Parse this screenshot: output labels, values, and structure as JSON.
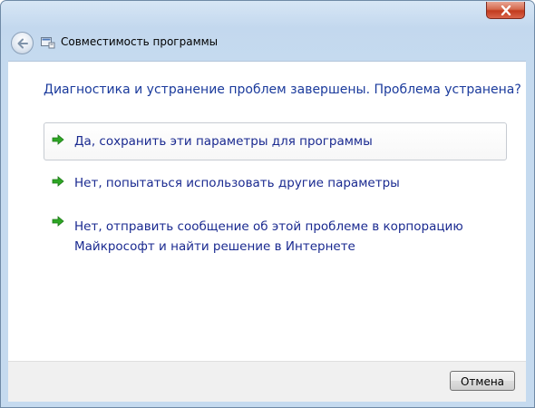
{
  "window": {
    "title": "Совместимость программы"
  },
  "heading": "Диагностика и устранение проблем завершены. Проблема устранена?",
  "options": [
    {
      "label": "Да, сохранить эти параметры для программы",
      "icon": "green-arrow-icon",
      "selected": true
    },
    {
      "label": "Нет, попытаться использовать другие параметры",
      "icon": "green-arrow-icon",
      "selected": false
    },
    {
      "label": "Нет, отправить сообщение об этой проблеме в корпорацию Майкрософт и найти решение в Интернете",
      "icon": "green-arrow-icon",
      "selected": false
    }
  ],
  "footer": {
    "cancel_label": "Отмена"
  },
  "colors": {
    "link_blue": "#1a2a90",
    "heading_blue": "#1a3a9c",
    "arrow_green": "#2ea624"
  }
}
